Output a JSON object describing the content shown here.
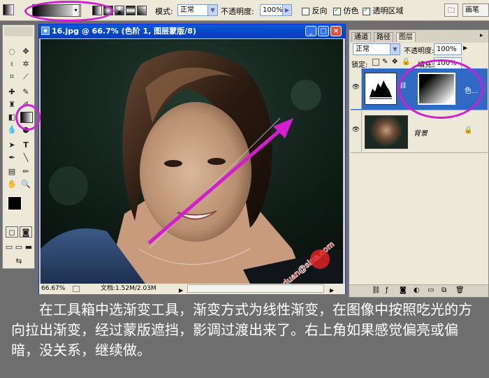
{
  "options_bar": {
    "mode_label": "模式:",
    "mode_value": "正常",
    "opacity_label": "不透明度:",
    "opacity_value": "100%",
    "reverse_label": "反向",
    "dither_label": "仿色",
    "transparency_label": "透明区域",
    "palette_label": "画笔"
  },
  "document": {
    "title": "16.jpg @ 66.7% (色阶 1, 图层蒙版/8)",
    "zoom": "66.67%",
    "doc_size": "文档:1.52M/2.03M",
    "watermark_text": "wangduan@sina.com"
  },
  "layers_panel": {
    "tabs": [
      "通道",
      "路径",
      "图层"
    ],
    "blend_mode": "正常",
    "opacity_label": "不透明度:",
    "opacity_value": "100%",
    "lock_label": "锁定:",
    "fill_label": "填充:",
    "fill_value": "100%",
    "layers": [
      {
        "name": "色...",
        "type": "adjustment-with-mask"
      },
      {
        "name": "背景",
        "type": "background"
      }
    ]
  },
  "caption": "在工具箱中选渐变工具，渐变方式为线性渐变，在图像中按照吃光的方向拉出渐变，经过蒙版遮挡，影调过渡出来了。右上角如果感觉偏亮或偏暗，没关系，继续做。",
  "colors": {
    "highlight_ring": "#d21ed0",
    "gradient_arrow": "#d21ed0",
    "title_bar": "#0846c4",
    "caption_bg": "#6e6e6e"
  }
}
